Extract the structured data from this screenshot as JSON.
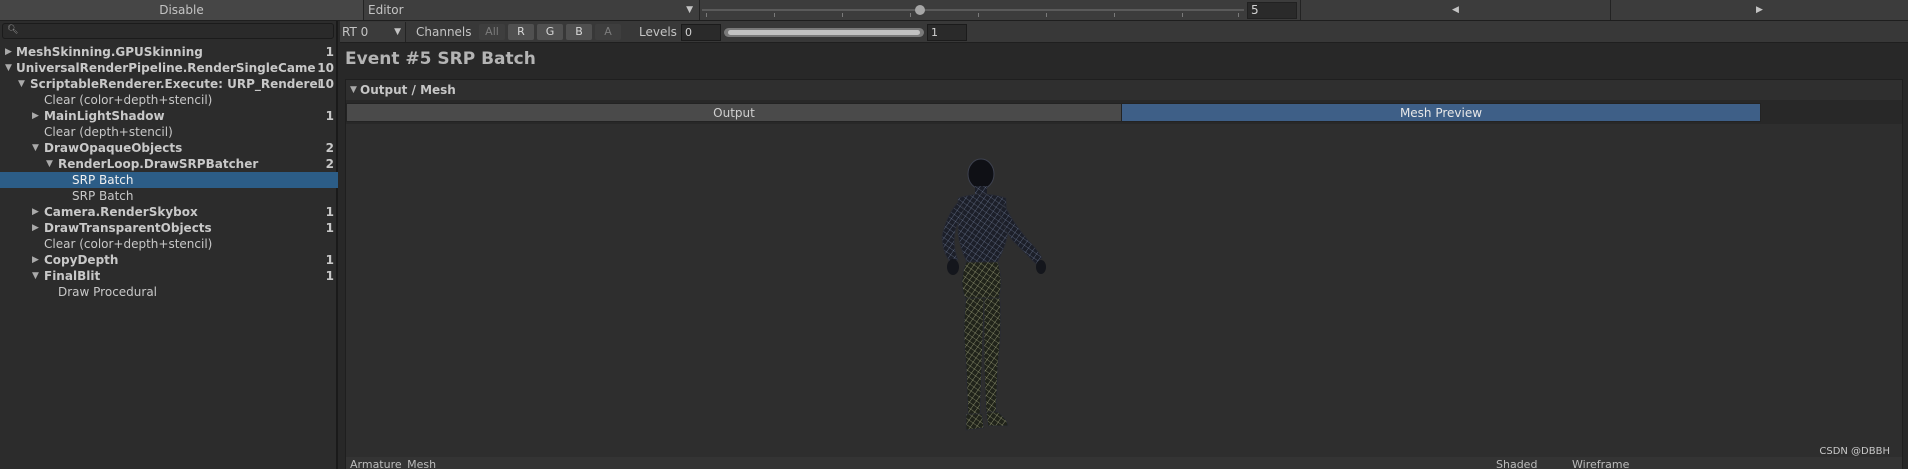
{
  "toolbar": {
    "disable_label": "Disable",
    "editor_select_value": "Editor",
    "event_number_value": "5",
    "prev_icon": "triangle-left-icon",
    "next_icon": "triangle-right-icon"
  },
  "hierarchy": {
    "search_placeholder": "",
    "search_icon": "search-icon",
    "rows": [
      {
        "label": "MeshSkinning.GPUSkinning",
        "count": "1"
      },
      {
        "label": "UniversalRenderPipeline.RenderSingleCameraInternal",
        "count": "10"
      },
      {
        "label": "ScriptableRenderer.Execute: URP_Renderer",
        "count": "10"
      },
      {
        "label": "Clear (color+depth+stencil)",
        "count": ""
      },
      {
        "label": "MainLightShadow",
        "count": "1"
      },
      {
        "label": "Clear (depth+stencil)",
        "count": ""
      },
      {
        "label": "DrawOpaqueObjects",
        "count": "2"
      },
      {
        "label": "RenderLoop.DrawSRPBatcher",
        "count": "2"
      },
      {
        "label": "SRP Batch",
        "count": ""
      },
      {
        "label": "SRP Batch",
        "count": ""
      },
      {
        "label": "Camera.RenderSkybox",
        "count": "1"
      },
      {
        "label": "DrawTransparentObjects",
        "count": "1"
      },
      {
        "label": "Clear (color+depth+stencil)",
        "count": ""
      },
      {
        "label": "CopyDepth",
        "count": "1"
      },
      {
        "label": "FinalBlit",
        "count": "1"
      },
      {
        "label": "Draw Procedural",
        "count": ""
      }
    ]
  },
  "subbar": {
    "rt_select_value": "RT 0",
    "channels_label": "Channels",
    "channels": [
      "All",
      "R",
      "G",
      "B",
      "A"
    ],
    "levels_label": "Levels",
    "levels_min": "0",
    "levels_max": "1",
    "levels_range": [
      0,
      1
    ]
  },
  "event_title": "Event #5 SRP Batch",
  "output_group": {
    "title": "Output / Mesh",
    "tabs": [
      "Output",
      "Mesh Preview"
    ],
    "active_tab": "Mesh Preview",
    "preview_content": "wireframe-character-mesh",
    "watermark": "CSDN @DBBH",
    "bottom_left": "Armature_Mesh",
    "bottom_shading": "Shaded",
    "bottom_wireframe": "Wireframe"
  },
  "colors": {
    "selection": "#2c5d87",
    "active_tab": "#3e5f87",
    "background": "#282828"
  }
}
